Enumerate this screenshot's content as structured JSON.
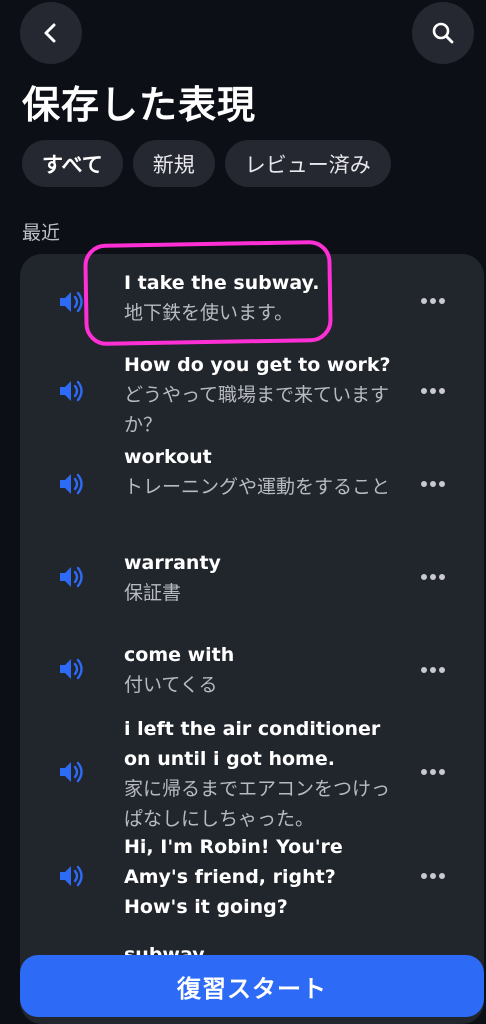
{
  "header": {
    "title": "保存した表現"
  },
  "filters": [
    {
      "label": "すべて"
    },
    {
      "label": "新規"
    },
    {
      "label": "レビュー済み"
    }
  ],
  "section_label": "最近",
  "items": [
    {
      "en": "I take the subway.",
      "ja": "地下鉄を使います。"
    },
    {
      "en": "How do you get to work?",
      "ja": "どうやって職場まで来ていますか？"
    },
    {
      "en": "workout",
      "ja": "トレーニングや運動をすること"
    },
    {
      "en": "warranty",
      "ja": "保証書"
    },
    {
      "en": "come with",
      "ja": "付いてくる"
    },
    {
      "en": "i left the air conditioner on until i got home.",
      "ja": "家に帰るまでエアコンをつけっぱなしにしちゃった。"
    },
    {
      "en": "Hi, I'm Robin! You're Amy's friend, right? How's it going?",
      "ja": ""
    },
    {
      "en": "subway",
      "ja": ""
    }
  ],
  "review_button": {
    "label": "復習スタート"
  },
  "colors": {
    "accent": "#2d6af6",
    "highlight": "#ff2fd6",
    "background": "#0d0f17",
    "card": "#21252c"
  },
  "icons": {
    "back": "chevron-left-icon",
    "search": "search-icon",
    "speaker": "speaker-icon",
    "more": "more-dots-icon"
  }
}
